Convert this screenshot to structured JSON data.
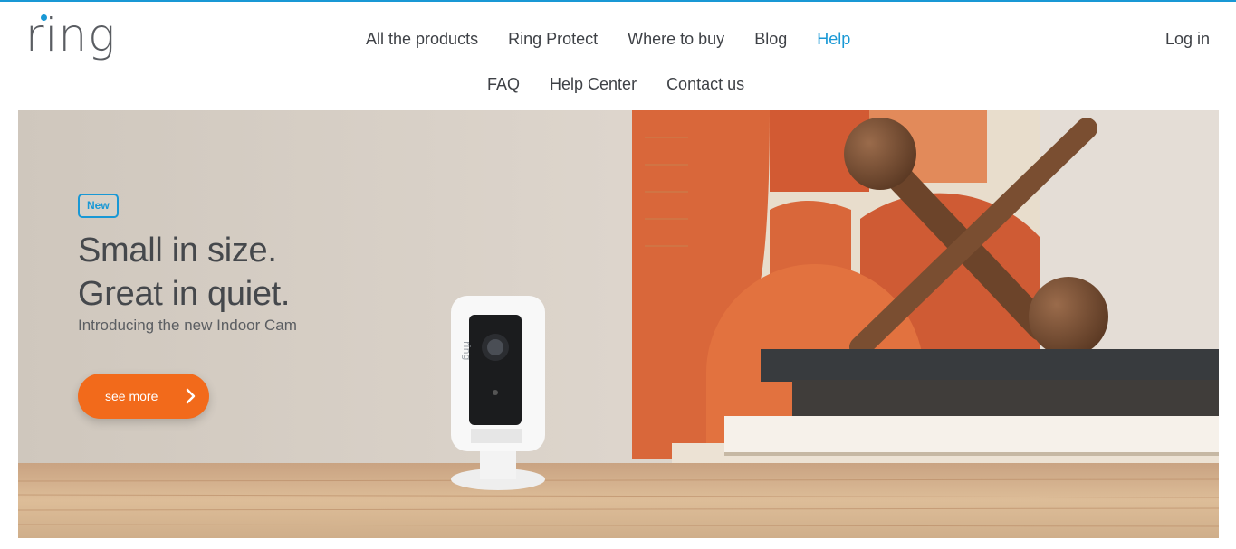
{
  "header": {
    "logo_text": "ring",
    "nav_main": [
      "All the products",
      "Ring Protect",
      "Where to buy",
      "Blog",
      "Help"
    ],
    "active_item": "Help",
    "nav_sub": [
      "FAQ",
      "Help Center",
      "Contact us"
    ],
    "login_label": "Log in"
  },
  "hero": {
    "badge": "New",
    "headline_line1": "Small in size.",
    "headline_line2": "Great in quiet.",
    "subline": "Introducing the new Indoor Cam",
    "cta_label": "see more",
    "cta_icon": "chevron-right-icon",
    "camera_brand_text": "ring"
  },
  "colors": {
    "accent": "#1998d5",
    "cta": "#f26a1b",
    "text": "#3e4146"
  }
}
